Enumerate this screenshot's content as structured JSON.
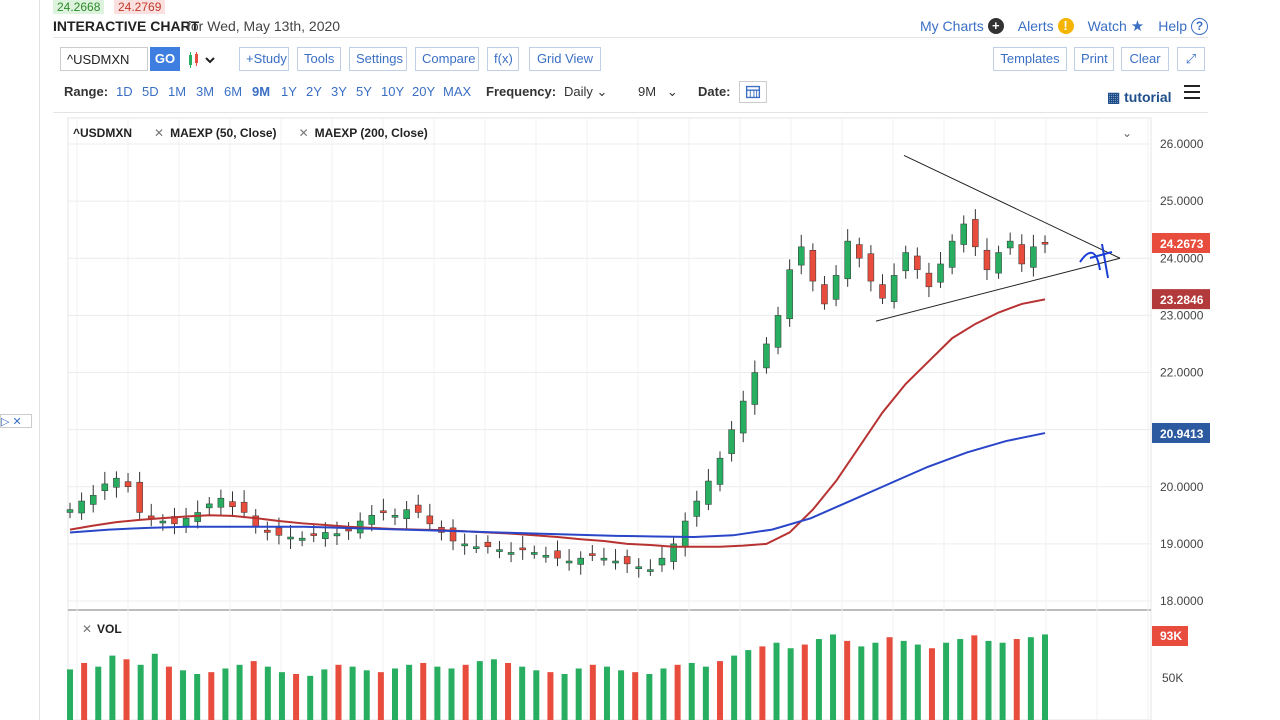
{
  "ticker": {
    "bid": "24.2668",
    "ask": "24.2769"
  },
  "header": {
    "title": "INTERACTIVE CHART",
    "date_text": "for Wed, May 13th, 2020",
    "links": [
      {
        "label": "My Charts",
        "icon": "plus-icon"
      },
      {
        "label": "Alerts",
        "icon": "warning-icon"
      },
      {
        "label": "Watch",
        "icon": "star-icon"
      },
      {
        "label": "Help",
        "icon": "question-icon"
      }
    ]
  },
  "toolbar": {
    "symbol": "^USDMXN",
    "go": "GO",
    "study": "+Study",
    "tools": "Tools",
    "settings": "Settings",
    "compare": "Compare",
    "fx": "f(x)",
    "grid_view": "Grid View",
    "templates": "Templates",
    "print": "Print",
    "clear": "Clear",
    "expand": "⤢"
  },
  "range": {
    "label": "Range:",
    "options": [
      "1D",
      "5D",
      "1M",
      "3M",
      "6M",
      "9M",
      "1Y",
      "2Y",
      "3Y",
      "5Y",
      "10Y",
      "20Y",
      "MAX"
    ],
    "active": "9M",
    "freq_label": "Frequency:",
    "freq_value": "Daily",
    "span_value": "9M",
    "date_label": "Date:",
    "tutorial": "tutorial"
  },
  "legend": {
    "symbol": "^USDMXN",
    "ma50": "MAEXP (50, Close)",
    "ma200": "MAEXP (200, Close)",
    "vol": "VOL"
  },
  "colors": {
    "up": "#27ae60",
    "down": "#e74c3c",
    "ma50": "#b83232",
    "ma200": "#2946c8",
    "price_badge": "#e74c3c",
    "ma50_badge": "#b33a3a",
    "ma200_badge": "#2c5aa0"
  },
  "chart_data": {
    "type": "candlestick",
    "y_ticks": [
      "26.0000",
      "25.0000",
      "24.0000",
      "23.0000",
      "22.0000",
      "21.0000",
      "20.0000",
      "19.0000",
      "18.0000"
    ],
    "ylim": [
      18,
      26
    ],
    "last_price": "24.2673",
    "ma50_last": "23.2846",
    "ma200_last": "20.9413",
    "vol_ticks": [
      "93K",
      "50K"
    ],
    "close_series": [
      19.6,
      19.75,
      19.85,
      20.05,
      20.15,
      20.0,
      19.55,
      19.45,
      19.4,
      19.35,
      19.45,
      19.55,
      19.7,
      19.8,
      19.65,
      19.55,
      19.3,
      19.2,
      19.15,
      19.12,
      19.1,
      19.15,
      19.2,
      19.18,
      19.25,
      19.4,
      19.5,
      19.55,
      19.5,
      19.6,
      19.55,
      19.35,
      19.2,
      19.05,
      19.0,
      18.95,
      18.95,
      18.9,
      18.85,
      18.9,
      18.85,
      18.8,
      18.75,
      18.7,
      18.75,
      18.8,
      18.75,
      18.7,
      18.65,
      18.6,
      18.55,
      18.75,
      19.0,
      19.4,
      19.75,
      20.1,
      20.5,
      21.0,
      21.5,
      22.0,
      22.5,
      23.0,
      23.8,
      24.2,
      23.6,
      23.2,
      23.7,
      24.3,
      24.0,
      23.6,
      23.3,
      23.7,
      24.1,
      23.8,
      23.5,
      23.9,
      24.3,
      24.6,
      24.2,
      23.8,
      24.1,
      24.3,
      23.9,
      24.2,
      24.27
    ],
    "ma50_series": [
      19.25,
      19.32,
      19.38,
      19.42,
      19.45,
      19.48,
      19.5,
      19.49,
      19.45,
      19.4,
      19.36,
      19.33,
      19.3,
      19.28,
      19.26,
      19.25,
      19.24,
      19.22,
      19.2,
      19.18,
      19.15,
      19.12,
      19.08,
      19.05,
      19.0,
      18.98,
      18.95,
      18.95,
      18.95,
      18.97,
      19.0,
      19.2,
      19.6,
      20.1,
      20.7,
      21.3,
      21.8,
      22.2,
      22.6,
      22.85,
      23.05,
      23.2,
      23.28
    ],
    "ma200_series": [
      19.2,
      19.25,
      19.28,
      19.3,
      19.3,
      19.3,
      19.3,
      19.28,
      19.26,
      19.24,
      19.22,
      19.2,
      19.18,
      19.16,
      19.14,
      19.13,
      19.12,
      19.15,
      19.25,
      19.45,
      19.75,
      20.05,
      20.35,
      20.6,
      20.8,
      20.94
    ],
    "volume_series": [
      55,
      62,
      58,
      70,
      66,
      60,
      72,
      58,
      54,
      50,
      52,
      56,
      60,
      64,
      58,
      52,
      50,
      48,
      55,
      60,
      58,
      54,
      52,
      56,
      60,
      62,
      58,
      56,
      60,
      64,
      66,
      62,
      58,
      54,
      52,
      50,
      56,
      60,
      58,
      54,
      52,
      50,
      56,
      60,
      62,
      58,
      64,
      70,
      76,
      80,
      84,
      78,
      82,
      88,
      93,
      86,
      80,
      84,
      90,
      86,
      82,
      78,
      84,
      88,
      92,
      86,
      84,
      88,
      90,
      93
    ]
  }
}
